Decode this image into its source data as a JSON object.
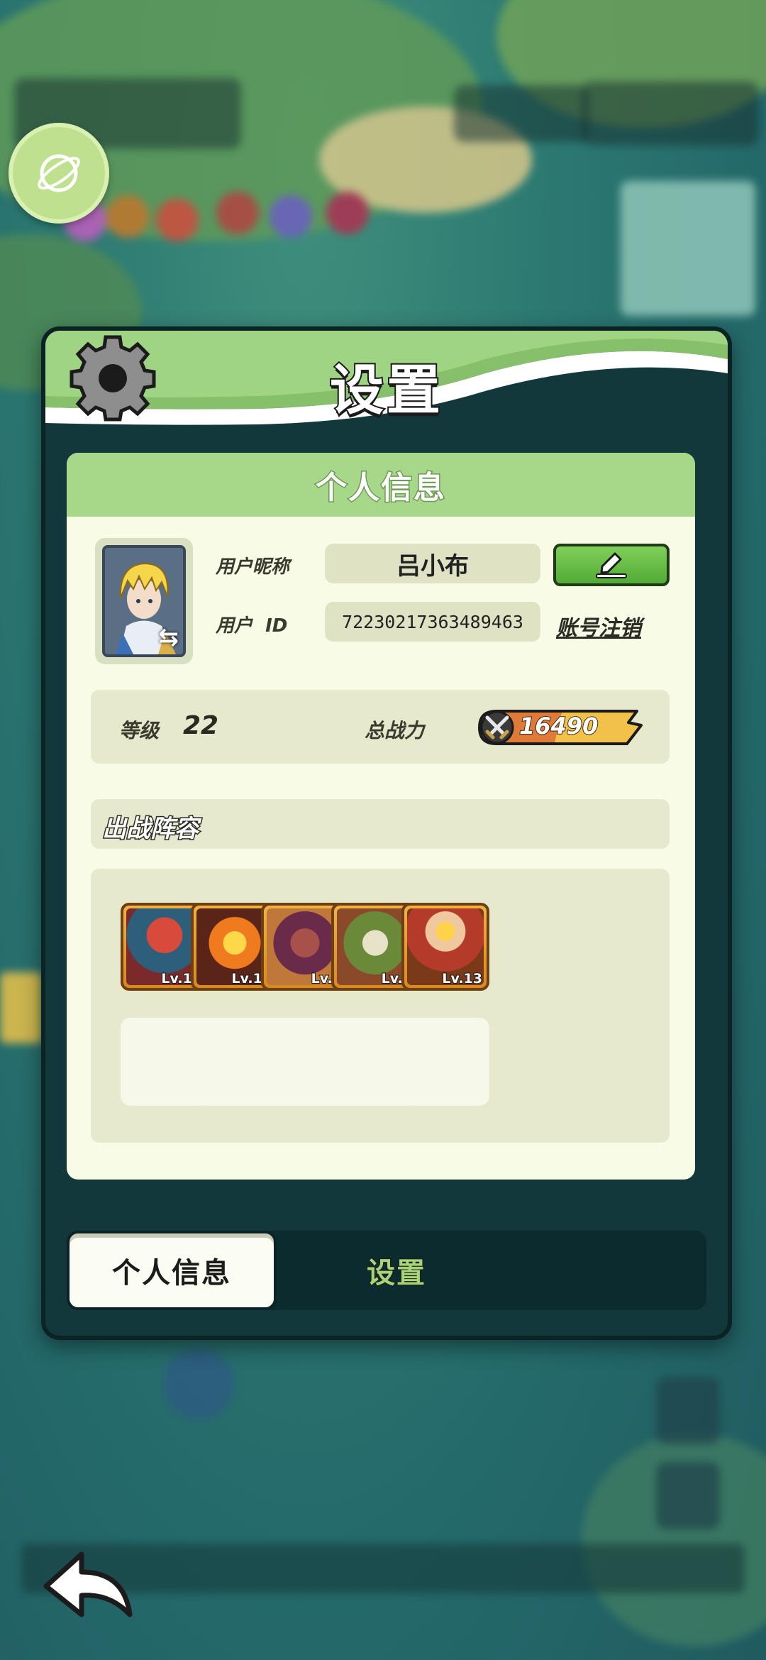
{
  "modal": {
    "title": "设置",
    "section_title": "个人信息"
  },
  "profile": {
    "nickname_label": "用户昵称",
    "nickname": "吕小布",
    "id_label": "用户  ID",
    "user_id": "72230217363489463",
    "logout_link": "账号注销"
  },
  "stats": {
    "level_label": "等级",
    "level": "22",
    "power_label": "总战力",
    "power": "16490"
  },
  "lineup": {
    "title": "出战阵容",
    "heroes": [
      {
        "level": "Lv.10",
        "portrait": "red-haired-heroine"
      },
      {
        "level": "Lv.10",
        "portrait": "fire-golem"
      },
      {
        "level": "Lv.9",
        "portrait": "horned-beast"
      },
      {
        "level": "Lv.9",
        "portrait": "crocodile-warrior"
      },
      {
        "level": "Lv.13",
        "portrait": "crowned-dwarf-king"
      }
    ]
  },
  "tabs": {
    "active": "个人信息",
    "inactive": "设置"
  },
  "colors": {
    "header_green": "#a7d88a",
    "modal_dark": "#12383c",
    "panel_bg": "#f8fbe5",
    "edit_button": "#53aa36",
    "power_badge": "#f2c14a"
  },
  "icons": [
    "gear-icon",
    "pencil-icon",
    "swap-icon",
    "sword-icon",
    "back-arrow-icon",
    "planet-icon"
  ]
}
